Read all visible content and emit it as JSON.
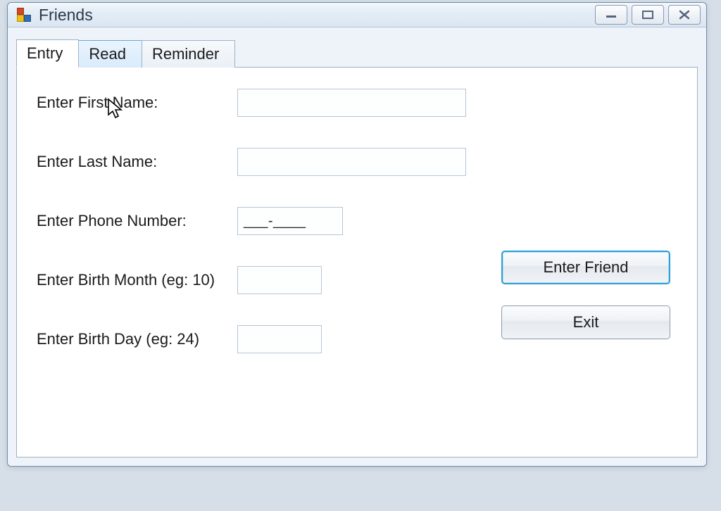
{
  "window": {
    "title": "Friends"
  },
  "tabs": {
    "entry": "Entry",
    "read": "Read",
    "reminder": "Reminder"
  },
  "labels": {
    "first_name": "Enter First Name:",
    "last_name": "Enter Last Name:",
    "phone": "Enter Phone Number:",
    "birth_month": "Enter Birth Month (eg: 10)",
    "birth_day": "Enter Birth Day (eg: 24)"
  },
  "fields": {
    "first_name_value": "",
    "last_name_value": "",
    "phone_mask": "___-____",
    "birth_month_value": "",
    "birth_day_value": ""
  },
  "buttons": {
    "enter_friend": "Enter Friend",
    "exit": "Exit"
  }
}
